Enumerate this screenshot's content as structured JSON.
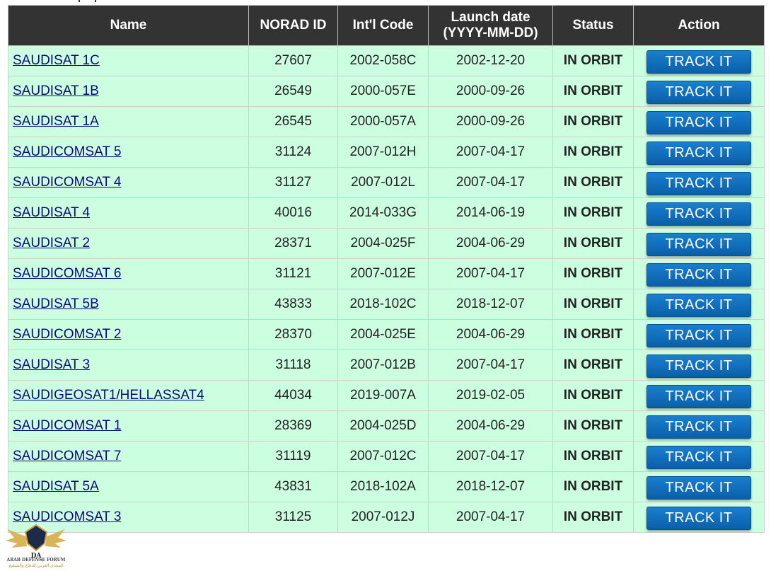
{
  "table": {
    "headers": {
      "name": "Name",
      "norad": "NORAD ID",
      "intl": "Int'l Code",
      "launch_line1": "Launch date",
      "launch_line2": "(YYYY-MM-DD)",
      "status": "Status",
      "action": "Action"
    },
    "button_label": "TRACK IT",
    "rows": [
      {
        "name": "SAUDISAT 1C",
        "norad": "27607",
        "intl": "2002-058C",
        "launch": "2002-12-20",
        "status": "IN ORBIT"
      },
      {
        "name": "SAUDISAT 1B",
        "norad": "26549",
        "intl": "2000-057E",
        "launch": "2000-09-26",
        "status": "IN ORBIT"
      },
      {
        "name": "SAUDISAT 1A",
        "norad": "26545",
        "intl": "2000-057A",
        "launch": "2000-09-26",
        "status": "IN ORBIT"
      },
      {
        "name": "SAUDICOMSAT 5",
        "norad": "31124",
        "intl": "2007-012H",
        "launch": "2007-04-17",
        "status": "IN ORBIT"
      },
      {
        "name": "SAUDICOMSAT 4",
        "norad": "31127",
        "intl": "2007-012L",
        "launch": "2007-04-17",
        "status": "IN ORBIT"
      },
      {
        "name": "SAUDISAT 4",
        "norad": "40016",
        "intl": "2014-033G",
        "launch": "2014-06-19",
        "status": "IN ORBIT"
      },
      {
        "name": "SAUDISAT 2",
        "norad": "28371",
        "intl": "2004-025F",
        "launch": "2004-06-29",
        "status": "IN ORBIT"
      },
      {
        "name": "SAUDICOMSAT 6",
        "norad": "31121",
        "intl": "2007-012E",
        "launch": "2007-04-17",
        "status": "IN ORBIT"
      },
      {
        "name": "SAUDISAT 5B",
        "norad": "43833",
        "intl": "2018-102C",
        "launch": "2018-12-07",
        "status": "IN ORBIT"
      },
      {
        "name": "SAUDICOMSAT 2",
        "norad": "28370",
        "intl": "2004-025E",
        "launch": "2004-06-29",
        "status": "IN ORBIT"
      },
      {
        "name": "SAUDISAT 3",
        "norad": "31118",
        "intl": "2007-012B",
        "launch": "2007-04-17",
        "status": "IN ORBIT"
      },
      {
        "name": "SAUDIGEOSAT1/HELLASSAT4",
        "norad": "44034",
        "intl": "2019-007A",
        "launch": "2019-02-05",
        "status": "IN ORBIT"
      },
      {
        "name": "SAUDICOMSAT 1",
        "norad": "28369",
        "intl": "2004-025D",
        "launch": "2004-06-29",
        "status": "IN ORBIT"
      },
      {
        "name": "SAUDICOMSAT 7",
        "norad": "31119",
        "intl": "2007-012C",
        "launch": "2007-04-17",
        "status": "IN ORBIT"
      },
      {
        "name": "SAUDISAT 5A",
        "norad": "43831",
        "intl": "2018-102A",
        "launch": "2018-12-07",
        "status": "IN ORBIT"
      },
      {
        "name": "SAUDICOMSAT 3",
        "norad": "31125",
        "intl": "2007-012J",
        "launch": "2007-04-17",
        "status": "IN ORBIT"
      }
    ]
  },
  "watermark": {
    "monogram": "DA",
    "line1": "ARAB DEFENSE FORUM",
    "line2": "المنتدى العربي للدفاع والتسليح"
  },
  "colors": {
    "header_bg": "#333333",
    "row_bg": "#ccffe0",
    "button_bg": "#0a6dbf",
    "link": "#0a0a7a"
  }
}
